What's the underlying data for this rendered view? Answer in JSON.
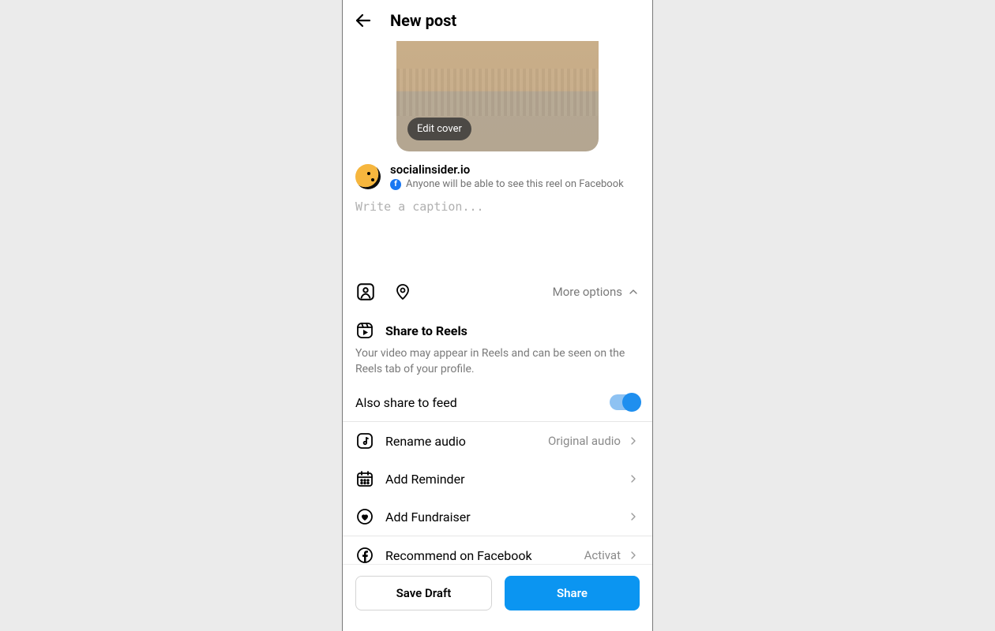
{
  "header": {
    "title": "New post"
  },
  "cover": {
    "edit_label": "Edit cover"
  },
  "user": {
    "username": "socialinsider.io",
    "visibility_text": "Anyone will be able to see this reel on Facebook"
  },
  "caption": {
    "placeholder": "Write a caption..."
  },
  "options": {
    "more_label": "More options"
  },
  "reels": {
    "title": "Share to Reels",
    "description": "Your video may appear in Reels and can be seen on the Reels tab of your profile.",
    "feed_label": "Also share to feed",
    "feed_enabled": true
  },
  "rows": {
    "rename_audio": {
      "label": "Rename audio",
      "value": "Original audio"
    },
    "add_reminder": {
      "label": "Add Reminder"
    },
    "add_fundraiser": {
      "label": "Add Fundraiser"
    },
    "recommend_fb": {
      "label": "Recommend on Facebook",
      "value": "Activat"
    }
  },
  "footer": {
    "save_draft": "Save Draft",
    "share": "Share"
  }
}
